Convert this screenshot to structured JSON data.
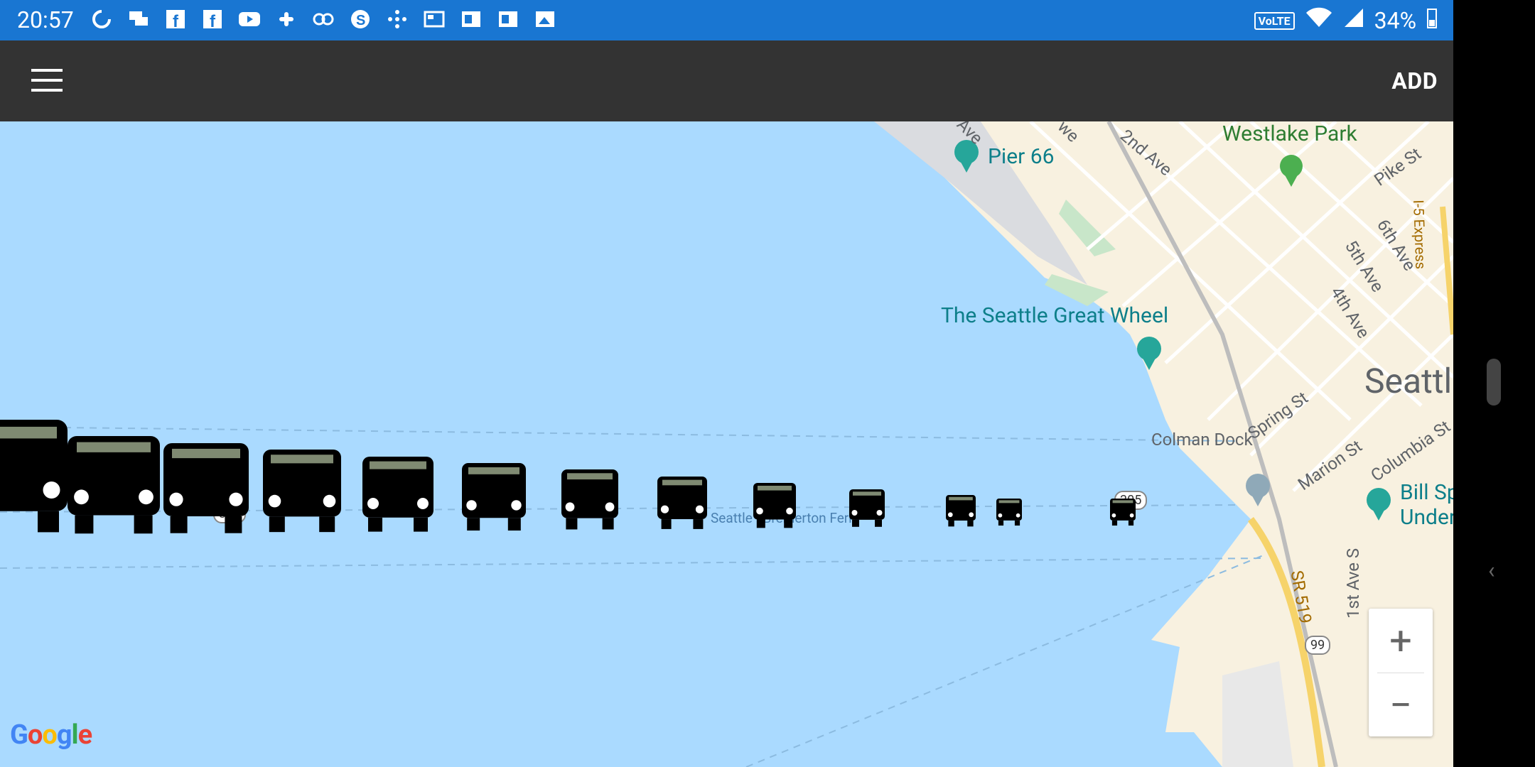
{
  "status_bar": {
    "time": "20:57",
    "volte": "VoLTE",
    "battery": "34%",
    "notif_icons": [
      "sync-icon",
      "chat-icon",
      "facebook-icon",
      "facebook-icon",
      "youtube-icon",
      "slack-icon",
      "owl-icon",
      "skype-icon",
      "dots-icon",
      "news-icon",
      "outlook-icon",
      "outlook-icon",
      "image-icon"
    ]
  },
  "toolbar": {
    "menu_icon": "hamburger-icon",
    "add_label": "ADD"
  },
  "map": {
    "poi": {
      "pier66": "Pier 66",
      "great_wheel": "The Seattle Great Wheel",
      "westlake": "Westlake Park",
      "bill_sp": "Bill Sp",
      "under": "Under",
      "colman": "Colman Dock"
    },
    "streets": {
      "second_ave": "2nd Ave",
      "pike": "Pike St",
      "fifth": "5th Ave",
      "sixth": "6th Ave",
      "fourth": "4th Ave",
      "spring": "Spring St",
      "marion": "Marion St",
      "columbia": "Columbia St",
      "first_s": "1st Ave S",
      "sr519": "SR 519",
      "i5exp": "I-5 Express",
      "ave_frag": "Ave",
      "we_frag": "we"
    },
    "city": "Seattl",
    "ferry": "Seattle - Bremerton Ferry",
    "shields": {
      "r304": "304",
      "r305": "305",
      "r99": "99"
    },
    "logo": "Google"
  },
  "markers": {
    "icon": "bus-icon",
    "count": 13
  }
}
